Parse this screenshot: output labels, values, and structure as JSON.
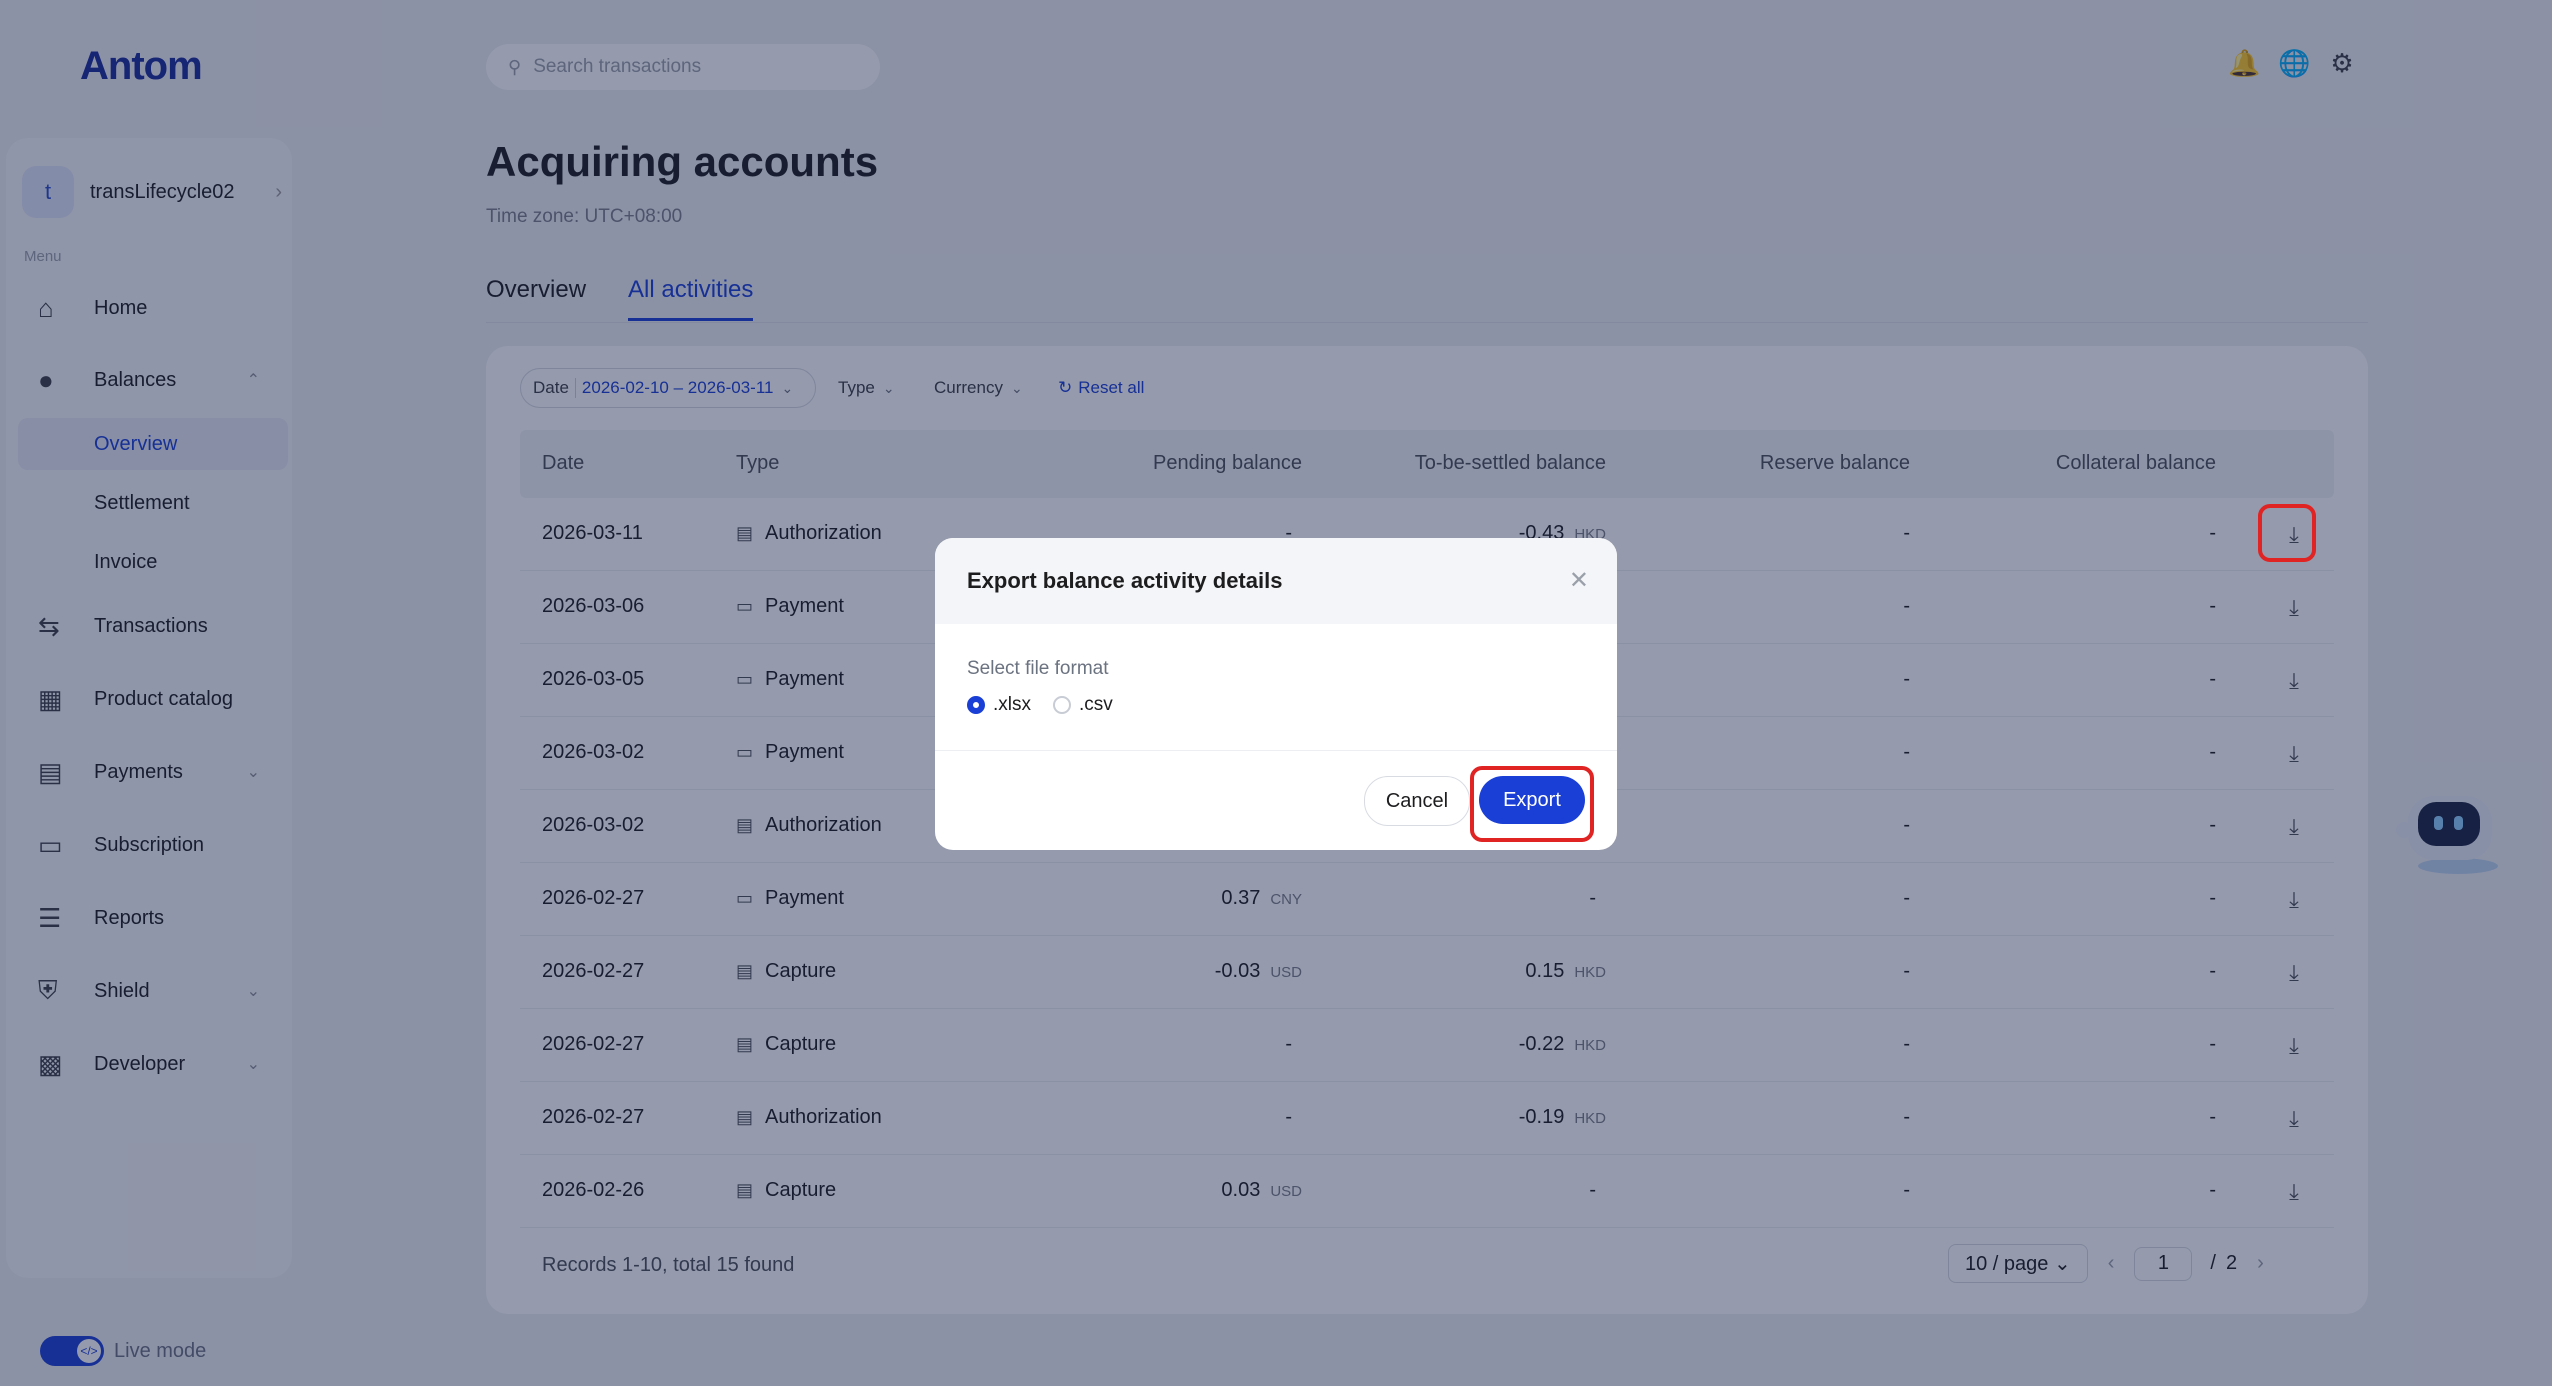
{
  "app": {
    "logo": "Antom"
  },
  "search": {
    "placeholder": "Search transactions"
  },
  "top_icons": [
    "bell-icon",
    "globe-icon",
    "settings-icon"
  ],
  "account": {
    "initial": "t",
    "name": "transLifecycle02"
  },
  "sidebar": {
    "menu_label": "Menu",
    "items": [
      {
        "label": "Home",
        "icon": "home-icon"
      },
      {
        "label": "Balances",
        "icon": "balances-icon",
        "expanded": true
      },
      {
        "label": "Overview",
        "sub": true,
        "active": true
      },
      {
        "label": "Settlement",
        "sub": true
      },
      {
        "label": "Invoice",
        "sub": true
      },
      {
        "label": "Transactions",
        "icon": "transactions-icon"
      },
      {
        "label": "Product catalog",
        "icon": "catalog-icon"
      },
      {
        "label": "Payments",
        "icon": "payments-icon"
      },
      {
        "label": "Subscription",
        "icon": "subscription-icon"
      },
      {
        "label": "Reports",
        "icon": "reports-icon"
      },
      {
        "label": "Shield",
        "icon": "shield-icon"
      },
      {
        "label": "Developer",
        "icon": "developer-icon"
      }
    ],
    "live_mode": "Live mode"
  },
  "page": {
    "title": "Acquiring accounts",
    "timezone": "Time zone: UTC+08:00",
    "tabs": [
      "Overview",
      "All activities"
    ],
    "active_tab": "All activities"
  },
  "filters": {
    "date_label": "Date",
    "date_value": "2026-02-10 – 2026-03-11",
    "type": "Type",
    "currency": "Currency",
    "reset": "Reset all"
  },
  "table": {
    "headers": [
      "Date",
      "Type",
      "Pending balance",
      "To-be-settled balance",
      "Reserve balance",
      "Collateral balance"
    ],
    "rows": [
      {
        "date": "2026-03-11",
        "type": "Authorization",
        "pending": "-",
        "pending_cur": "",
        "tbs": "-0.43",
        "tbs_cur": "HKD",
        "reserve": "-",
        "collateral": "-"
      },
      {
        "date": "2026-03-06",
        "type": "Payment",
        "pending": "",
        "pending_cur": "",
        "tbs": "",
        "tbs_cur": "",
        "reserve": "-",
        "collateral": "-"
      },
      {
        "date": "2026-03-05",
        "type": "Payment",
        "pending": "",
        "pending_cur": "",
        "tbs": "",
        "tbs_cur": "",
        "reserve": "-",
        "collateral": "-"
      },
      {
        "date": "2026-03-02",
        "type": "Payment",
        "pending": "",
        "pending_cur": "",
        "tbs": "",
        "tbs_cur": "",
        "reserve": "-",
        "collateral": "-"
      },
      {
        "date": "2026-03-02",
        "type": "Authorization",
        "pending": "",
        "pending_cur": "",
        "tbs": "",
        "tbs_cur": "",
        "reserve": "-",
        "collateral": "-"
      },
      {
        "date": "2026-02-27",
        "type": "Payment",
        "pending": "0.37",
        "pending_cur": "CNY",
        "tbs": "-",
        "tbs_cur": "",
        "reserve": "-",
        "collateral": "-"
      },
      {
        "date": "2026-02-27",
        "type": "Capture",
        "pending": "-0.03",
        "pending_cur": "USD",
        "tbs": "0.15",
        "tbs_cur": "HKD",
        "reserve": "-",
        "collateral": "-"
      },
      {
        "date": "2026-02-27",
        "type": "Capture",
        "pending": "-",
        "pending_cur": "",
        "tbs": "-0.22",
        "tbs_cur": "HKD",
        "reserve": "-",
        "collateral": "-"
      },
      {
        "date": "2026-02-27",
        "type": "Authorization",
        "pending": "-",
        "pending_cur": "",
        "tbs": "-0.19",
        "tbs_cur": "HKD",
        "reserve": "-",
        "collateral": "-"
      },
      {
        "date": "2026-02-26",
        "type": "Capture",
        "pending": "0.03",
        "pending_cur": "USD",
        "tbs": "-",
        "tbs_cur": "",
        "reserve": "-",
        "collateral": "-"
      }
    ],
    "records_text": "Records 1-10, total 15 found"
  },
  "pagination": {
    "page_size": "10 / page",
    "current": "1",
    "separator": "/",
    "total_pages": "2"
  },
  "modal": {
    "title": "Export balance activity details",
    "format_label": "Select file format",
    "options": [
      ".xlsx",
      ".csv"
    ],
    "selected": ".xlsx",
    "cancel": "Cancel",
    "export": "Export"
  },
  "colors": {
    "accent": "#1a3fd6",
    "highlight": "#e02424"
  }
}
